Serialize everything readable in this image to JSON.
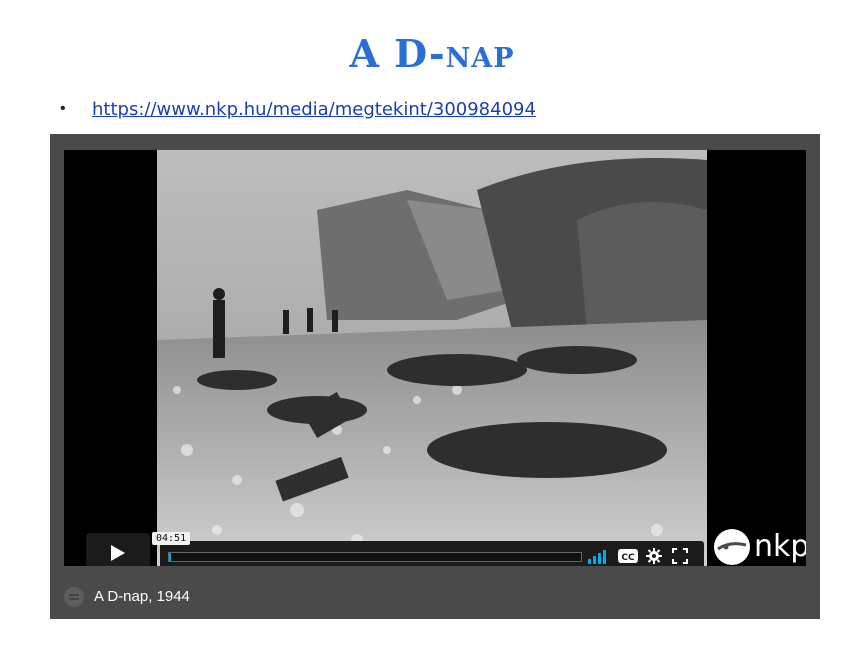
{
  "slide": {
    "title": "A D-nap",
    "bullet_symbol": "•",
    "link_text": "https://www.nkp.hu/media/megtekint/300984094"
  },
  "player": {
    "time_tooltip": "04:51",
    "progress_fraction": 0.0,
    "caption": "A D-nap, 1944",
    "logo_text": "nkp",
    "accent_color": "#00adef",
    "icons": [
      "play-icon",
      "volume-bars-icon",
      "closed-captions-icon",
      "settings-gear-icon",
      "fullscreen-icon",
      "nkp-logo-icon",
      "caption-menu-icon"
    ]
  }
}
